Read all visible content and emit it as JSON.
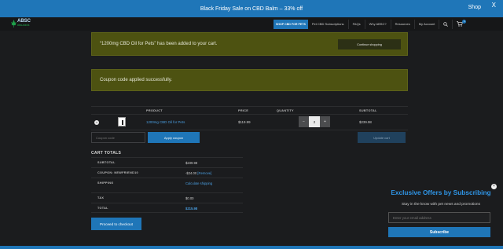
{
  "topbar": {
    "promo": "Black Friday Sale on CBD Balm – 33% off",
    "shop": "Shop",
    "close": "X"
  },
  "logo": {
    "name": "ABSC",
    "sub": "ORGANICS"
  },
  "nav": {
    "items": [
      "SHOP CBD FOR PETS",
      "Pet CBD Subscriptions",
      "FAQs",
      "Why ABSC?",
      "Resources",
      "My Account"
    ],
    "cart_count": "1"
  },
  "notices": {
    "added": "“1200mg CBD Oil for Pets” has been added to your cart.",
    "continue": "Continue shopping",
    "coupon": "Coupon code applied successfully."
  },
  "cart": {
    "headers": {
      "product": "PRODUCT",
      "price": "PRICE",
      "quantity": "QUANTITY",
      "subtotal": "SUBTOTAL"
    },
    "item": {
      "name": "1200mg CBD Oil for Pets",
      "price": "$119.99",
      "qty": "2",
      "subtotal": "$239.98"
    },
    "coupon_placeholder": "Coupon code",
    "apply": "Apply coupon",
    "update": "Update cart"
  },
  "totals": {
    "title": "CART TOTALS",
    "rows": [
      {
        "label": "SUBTOTAL",
        "value": "$239.98"
      },
      {
        "label": "COUPON: NEWFRIEND10",
        "value": "-$24.00",
        "remove": "[Remove]"
      },
      {
        "label": "SHIPPING",
        "value": "Calculate shipping"
      },
      {
        "label": "TAX",
        "value": "$0.00"
      },
      {
        "label": "TOTAL",
        "value": "$215.98"
      }
    ],
    "checkout": "Proceed to checkout"
  },
  "popup": {
    "title": "Exclusive Offers by Subscribing",
    "subtitle": "Stay in the know with pet news and promotions",
    "email_placeholder": "Enter your email address",
    "button": "Subscribe",
    "close": "×"
  },
  "colors": {
    "accent": "#1f76b8",
    "notice": "#4d5211",
    "background": "#1b1c1e",
    "link": "#4a9ee0"
  }
}
